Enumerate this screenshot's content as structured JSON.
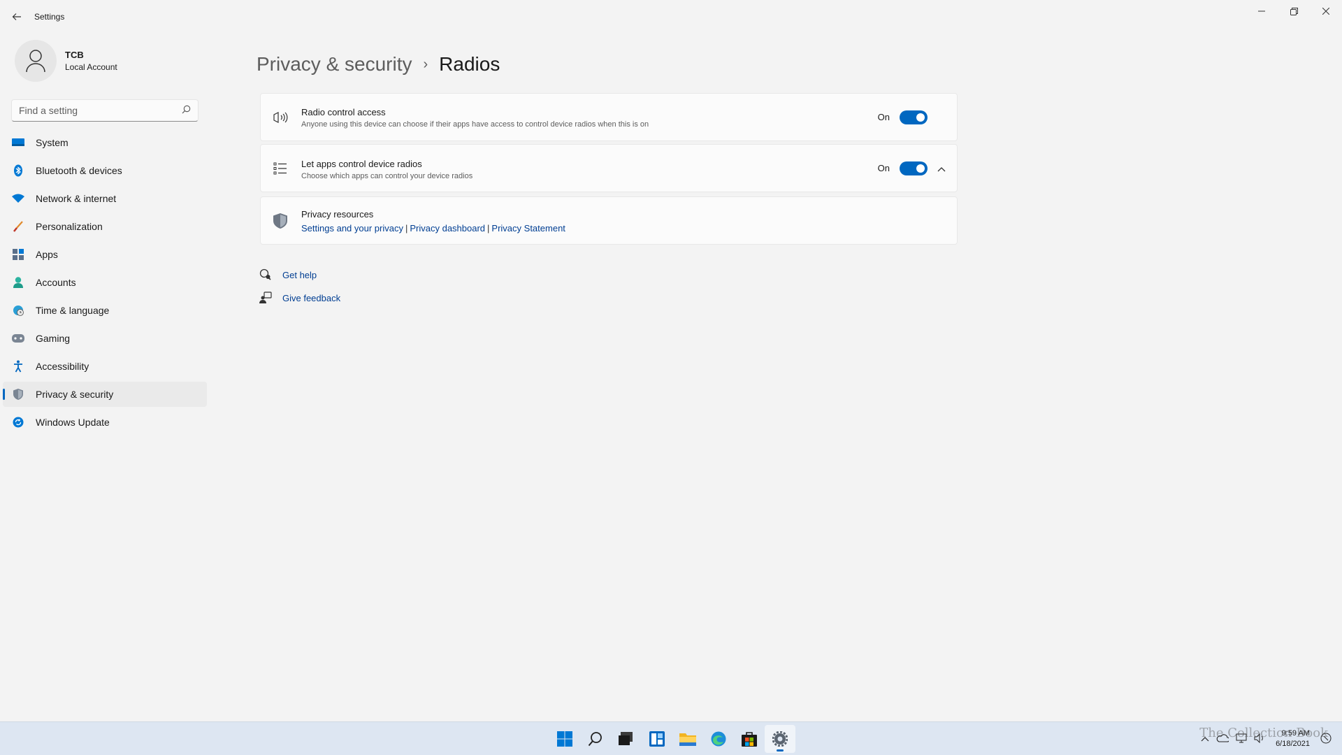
{
  "window": {
    "title": "Settings",
    "controls": [
      "minimize",
      "restore",
      "close"
    ]
  },
  "profile": {
    "name": "TCB",
    "account_type": "Local Account"
  },
  "search": {
    "placeholder": "Find a setting"
  },
  "sidebar": {
    "items": [
      {
        "label": "System",
        "icon": "system-icon"
      },
      {
        "label": "Bluetooth & devices",
        "icon": "bluetooth-icon"
      },
      {
        "label": "Network & internet",
        "icon": "wifi-icon"
      },
      {
        "label": "Personalization",
        "icon": "brush-icon"
      },
      {
        "label": "Apps",
        "icon": "apps-icon"
      },
      {
        "label": "Accounts",
        "icon": "person-icon"
      },
      {
        "label": "Time & language",
        "icon": "globe-clock-icon"
      },
      {
        "label": "Gaming",
        "icon": "gamepad-icon"
      },
      {
        "label": "Accessibility",
        "icon": "accessibility-icon"
      },
      {
        "label": "Privacy & security",
        "icon": "shield-icon",
        "active": true
      },
      {
        "label": "Windows Update",
        "icon": "update-icon"
      }
    ]
  },
  "breadcrumb": {
    "parent": "Privacy & security",
    "separator": "›",
    "current": "Radios"
  },
  "settings": {
    "radio_control": {
      "title": "Radio control access",
      "description": "Anyone using this device can choose if their apps have access to control device radios when this is on",
      "state_label": "On",
      "enabled": true
    },
    "apps_control": {
      "title": "Let apps control device radios",
      "description": "Choose which apps can control your device radios",
      "state_label": "On",
      "enabled": true,
      "expanded": true
    },
    "privacy_resources": {
      "title": "Privacy resources",
      "links": [
        "Settings and your privacy",
        "Privacy dashboard",
        "Privacy Statement"
      ],
      "separator": "|"
    }
  },
  "help": {
    "get_help": "Get help",
    "give_feedback": "Give feedback"
  },
  "taskbar": {
    "apps": [
      "start-icon",
      "search-icon",
      "task-view-icon",
      "widgets-icon",
      "file-explorer-icon",
      "edge-icon",
      "store-icon",
      "settings-icon"
    ],
    "active_app": "settings-icon",
    "clock_time": "9:59 AM",
    "clock_date": "6/18/2021"
  },
  "watermark": "The Collection Book",
  "colors": {
    "accent": "#0067c0",
    "link": "#003e92",
    "background": "#f3f3f3",
    "card": "#fbfbfb"
  }
}
